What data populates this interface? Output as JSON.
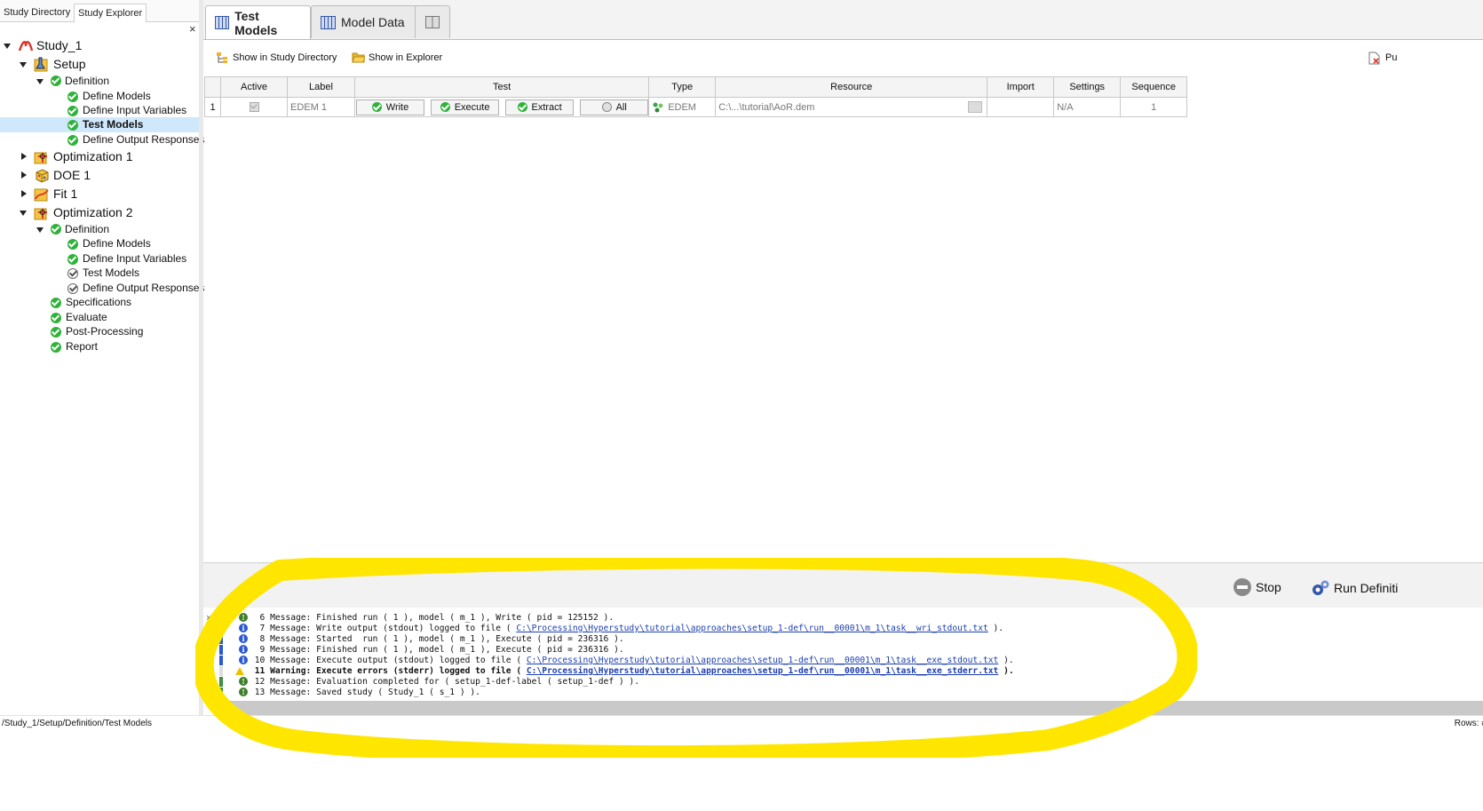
{
  "left_panel": {
    "tabs": [
      "Study Directory",
      "Study Explorer"
    ],
    "close_glyph": "×",
    "tree": {
      "study": "Study_1",
      "setup": "Setup",
      "definition": "Definition",
      "define_models": "Define Models",
      "define_input_variables": "Define Input Variables",
      "test_models": "Test Models",
      "define_output_responses": "Define Output Responses",
      "optimization1": "Optimization 1",
      "doe1": "DOE 1",
      "fit1": "Fit 1",
      "optimization2": "Optimization 2",
      "specifications": "Specifications",
      "evaluate": "Evaluate",
      "post_processing": "Post-Processing",
      "report": "Report"
    }
  },
  "top_tabs": [
    "Test Models",
    "Model Data"
  ],
  "toolbar": {
    "show_in_study_directory": "Show in Study Directory",
    "show_in_explorer": "Show in Explorer",
    "right_cut": "Pu"
  },
  "table": {
    "headers": [
      "Active",
      "Label",
      "Test",
      "Type",
      "Resource",
      "Import",
      "Settings",
      "Sequence"
    ],
    "row": {
      "index": "1",
      "label": "EDEM 1",
      "write": "Write",
      "execute": "Execute",
      "extract": "Extract",
      "all": "All",
      "type": "EDEM",
      "resource": "C:\\...\\tutorial\\AoR.dem",
      "import": "",
      "settings": "N/A",
      "sequence": "1"
    }
  },
  "run_bar": {
    "stop": "Stop",
    "run_definition": "Run Definiti"
  },
  "messages": [
    {
      "kind": "ok",
      "text": "  6 Message: Finished run ( 1 ), model ( m_1 ), Write ( pid = 125152 )."
    },
    {
      "kind": "info",
      "pre": "  7 Message: Write output (stdout) logged to file ( ",
      "link": "C:\\Processing\\Hyperstudy\\tutorial\\approaches\\setup_1-def\\run__00001\\m_1\\task__wri_stdout.txt",
      "post": " )."
    },
    {
      "kind": "info",
      "text": "  8 Message: Started  run ( 1 ), model ( m_1 ), Execute ( pid = 236316 )."
    },
    {
      "kind": "info",
      "text": "  9 Message: Finished run ( 1 ), model ( m_1 ), Execute ( pid = 236316 )."
    },
    {
      "kind": "info",
      "pre": " 10 Message: Execute output (stdout) logged to file ( ",
      "link": "C:\\Processing\\Hyperstudy\\tutorial\\approaches\\setup_1-def\\run__00001\\m_1\\task__exe_stdout.txt",
      "post": " )."
    },
    {
      "kind": "warn",
      "pre": " 11 Warning: Execute errors (stderr) logged to file ( ",
      "link": "C:\\Processing\\Hyperstudy\\tutorial\\approaches\\setup_1-def\\run__00001\\m_1\\task__exe_stderr.txt",
      "post": " )."
    },
    {
      "kind": "ok",
      "text": " 12 Message: Evaluation completed for ( setup_1-def-label ( setup_1-def ) )."
    },
    {
      "kind": "ok",
      "text": " 13 Message: Saved study ( Study_1 ( s_1 ) )."
    }
  ],
  "status_bar": {
    "path": "/Study_1/Setup/Definition/Test Models",
    "rows": "Rows: # ("
  },
  "colors": {
    "highlight": "#ffe600",
    "selection": "#cfe8fb",
    "ok_green": "#2fb23a",
    "info_blue": "#2a58d1",
    "link_blue": "#1d3fb0"
  }
}
